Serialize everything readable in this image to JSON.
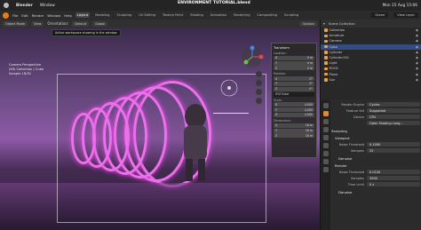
{
  "macbar": {
    "app": "Blender",
    "menu_window": "Window",
    "datetime": "Mon 15 Aug 15:06"
  },
  "title": "ENVIRONMENT TUTORIAL.blend",
  "topbar": {
    "menu": [
      "File",
      "Edit",
      "Render",
      "Window",
      "Help"
    ],
    "workspaces": [
      "Layout",
      "Modeling",
      "Sculpting",
      "UV Editing",
      "Texture Paint",
      "Shading",
      "Animation",
      "Rendering",
      "Compositing",
      "Scripting"
    ],
    "active_workspace": "Layout",
    "scene": "Scene",
    "view_layer": "View Layer"
  },
  "viewport_header": {
    "mode": "Object Mode",
    "view": "View",
    "orientation_label": "Orientation:",
    "orientation": "Default",
    "global": "Global",
    "options": "Options"
  },
  "tooltip": "Active workspace showing in the window",
  "viewport_info": {
    "line1": "Camera Perspective",
    "line2": "(69) Collection | Cube",
    "line3": "Sample 18/32"
  },
  "npanel": {
    "title": "Transform",
    "location_label": "Location:",
    "location": [
      [
        "X",
        "0 m"
      ],
      [
        "Y",
        "0 m"
      ],
      [
        "Z",
        "0 m"
      ]
    ],
    "rotation_label": "Rotation:",
    "rotation": [
      [
        "X",
        "0°"
      ],
      [
        "Y",
        "0°"
      ],
      [
        "Z",
        "0°"
      ]
    ],
    "mode_label": "XYZ Euler",
    "scale_label": "Scale:",
    "scale": [
      [
        "X",
        "4.000"
      ],
      [
        "Y",
        "4.000"
      ],
      [
        "Z",
        "4.000"
      ]
    ],
    "dimensions_label": "Dimensions:",
    "dimensions": [
      [
        "X",
        "18 m"
      ],
      [
        "Y",
        "18 m"
      ],
      [
        "Z",
        "18 m"
      ]
    ]
  },
  "outliner": {
    "header": "Scene Collection",
    "rows": [
      {
        "label": "Collection",
        "selected": false
      },
      {
        "label": "Armature",
        "selected": false
      },
      {
        "label": "Camera",
        "selected": false
      },
      {
        "label": "Cube",
        "selected": true
      },
      {
        "label": "Cylinder",
        "selected": false
      },
      {
        "label": "Cylinder.001",
        "selected": false
      },
      {
        "label": "Light",
        "selected": false
      },
      {
        "label": "ROCK",
        "selected": false
      },
      {
        "label": "Plane",
        "selected": false
      },
      {
        "label": "Sun",
        "selected": false
      }
    ]
  },
  "properties": {
    "render_engine_label": "Render Engine",
    "render_engine": "Cycles",
    "feature_set_label": "Feature Set",
    "feature_set": "Supported",
    "device_label": "Device",
    "device": "CPU",
    "osl": "Open Shading Lang...",
    "sampling": "Sampling",
    "viewport": "Viewport",
    "noise_threshold_label": "Noise Threshold",
    "noise_threshold": "0.1000",
    "samples_label": "Samples",
    "samples": "32",
    "denoise": "Denoise",
    "render": "Render",
    "render_noise_threshold": "0.0100",
    "render_samples": "3000",
    "time_limit_label": "Time Limit",
    "time_limit": "0 s",
    "render_denoise": "Denoise"
  }
}
